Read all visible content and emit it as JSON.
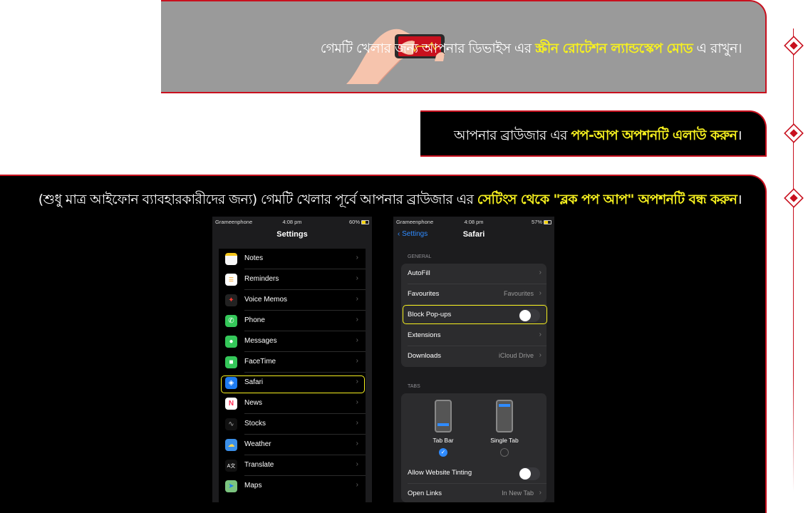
{
  "banner1": {
    "text_before": "গেমটি খেলার জন্য আপনার ডিভাইস এর ",
    "highlight": "স্ক্রীন রোটেশন ল্যান্ডস্কেপ মোড",
    "text_after": " এ রাখুন।"
  },
  "banner2": {
    "text_before": "আপনার ব্রাউজার এর ",
    "highlight": "পপ-আপ অপশনটি এলাউ করুন",
    "text_after": "।"
  },
  "banner3": {
    "text_before": "(শুধু মাত্র আইফোন ব্যাবহারকারীদের জন্য) গেমটি খেলার পূর্বে আপনার ব্রাউজার এর ",
    "highlight": "সেটিংস থেকে \"ব্লক পপ আপ\" অপশনটি বন্ধ করুন",
    "text_after": "।"
  },
  "colors": {
    "accent": "#c8101e",
    "highlight": "#f7f11f",
    "ios_blue": "#2f8bff"
  },
  "phone1": {
    "status": {
      "carrier": "Grameenphone",
      "time": "4:08 pm",
      "battery": "60%"
    },
    "title": "Settings",
    "items": [
      {
        "label": "Notes",
        "icon": "notes-icon",
        "color": "#f7f7f7"
      },
      {
        "label": "Reminders",
        "icon": "reminders-icon",
        "color": "#ffffff"
      },
      {
        "label": "Voice Memos",
        "icon": "voice-memos-icon",
        "color": "#222222"
      },
      {
        "label": "Phone",
        "icon": "phone-icon",
        "color": "#34c759"
      },
      {
        "label": "Messages",
        "icon": "messages-icon",
        "color": "#34c759"
      },
      {
        "label": "FaceTime",
        "icon": "facetime-icon",
        "color": "#34c759"
      },
      {
        "label": "Safari",
        "icon": "safari-icon",
        "color": "#1e7cf2"
      },
      {
        "label": "News",
        "icon": "news-icon",
        "color": "#ffffff"
      },
      {
        "label": "Stocks",
        "icon": "stocks-icon",
        "color": "#111111"
      },
      {
        "label": "Weather",
        "icon": "weather-icon",
        "color": "#3b8fe8"
      },
      {
        "label": "Translate",
        "icon": "translate-icon",
        "color": "#111111"
      },
      {
        "label": "Maps",
        "icon": "maps-icon",
        "color": "#7bc47f"
      }
    ]
  },
  "phone2": {
    "status": {
      "carrier": "Grameenphone",
      "time": "4:08 pm",
      "battery": "57%"
    },
    "back_label": "Settings",
    "title": "Safari",
    "general_header": "GENERAL",
    "general": [
      {
        "label": "AutoFill",
        "value": ""
      },
      {
        "label": "Favourites",
        "value": "Favourites"
      },
      {
        "label": "Block Pop-ups",
        "toggle": false
      },
      {
        "label": "Extensions",
        "value": ""
      },
      {
        "label": "Downloads",
        "value": "iCloud Drive"
      }
    ],
    "tabs_header": "TABS",
    "tab_options": [
      {
        "label": "Tab Bar",
        "selected": true
      },
      {
        "label": "Single Tab",
        "selected": false
      }
    ],
    "more": [
      {
        "label": "Allow Website Tinting",
        "toggle": false
      },
      {
        "label": "Open Links",
        "value": "In New Tab"
      }
    ]
  }
}
